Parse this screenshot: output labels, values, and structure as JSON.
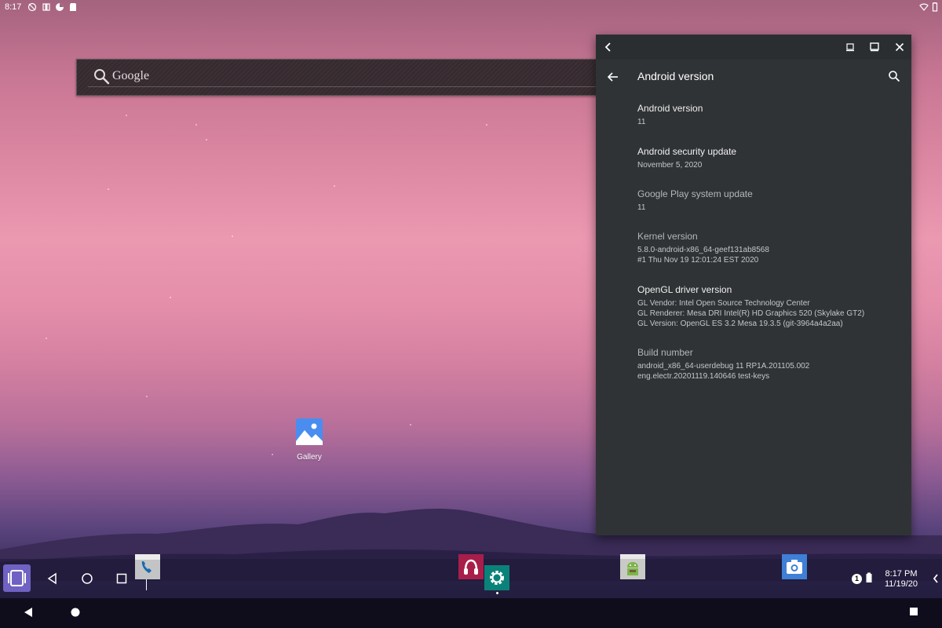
{
  "status_bar": {
    "time": "8:17",
    "icons": [
      "sync-off-icon",
      "android-debug-icon",
      "pie-chart-icon",
      "sd-card-icon",
      "wifi-icon",
      "battery-icon"
    ]
  },
  "google_search": {
    "label": "Google",
    "icon": "search-icon"
  },
  "desktop": {
    "gallery_label": "Gallery"
  },
  "settings_window": {
    "caption_buttons": [
      "back-icon",
      "minimize-icon",
      "maximize-icon",
      "close-icon"
    ],
    "title": "Android version",
    "items": [
      {
        "title": "Android version",
        "summary": [
          "11"
        ]
      },
      {
        "title": "Android security update",
        "summary": [
          "November 5, 2020"
        ]
      },
      {
        "title": "Google Play system update",
        "summary": [
          "11"
        ]
      },
      {
        "title": "Kernel version",
        "summary": [
          "5.8.0-android-x86_64-geef131ab8568",
          "#1 Thu Nov 19 12:01:24 EST 2020"
        ]
      },
      {
        "title": "OpenGL driver version",
        "summary": [
          "GL Vendor: Intel Open Source Technology Center",
          "GL Renderer: Mesa DRI Intel(R) HD Graphics 520 (Skylake GT2)",
          "GL Version: OpenGL ES 3.2 Mesa 19.3.5 (git-3964a4a2aa)"
        ]
      },
      {
        "title": "Build number",
        "summary": [
          "android_x86_64-userdebug 11 RP1A.201105.002",
          "eng.electr.20201119.140646 test-keys"
        ]
      }
    ]
  },
  "taskbar": {
    "apps": [
      "phone",
      "music",
      "settings",
      "android-tool",
      "camera"
    ],
    "notification_count": "1",
    "clock_time": "8:17 PM",
    "clock_date": "11/19/20"
  },
  "colors": {
    "window_bg": "#303336",
    "caption_bg": "#2b2e31",
    "launcher_accent": "#6f62c2",
    "settings_teal": "#0b8279"
  }
}
